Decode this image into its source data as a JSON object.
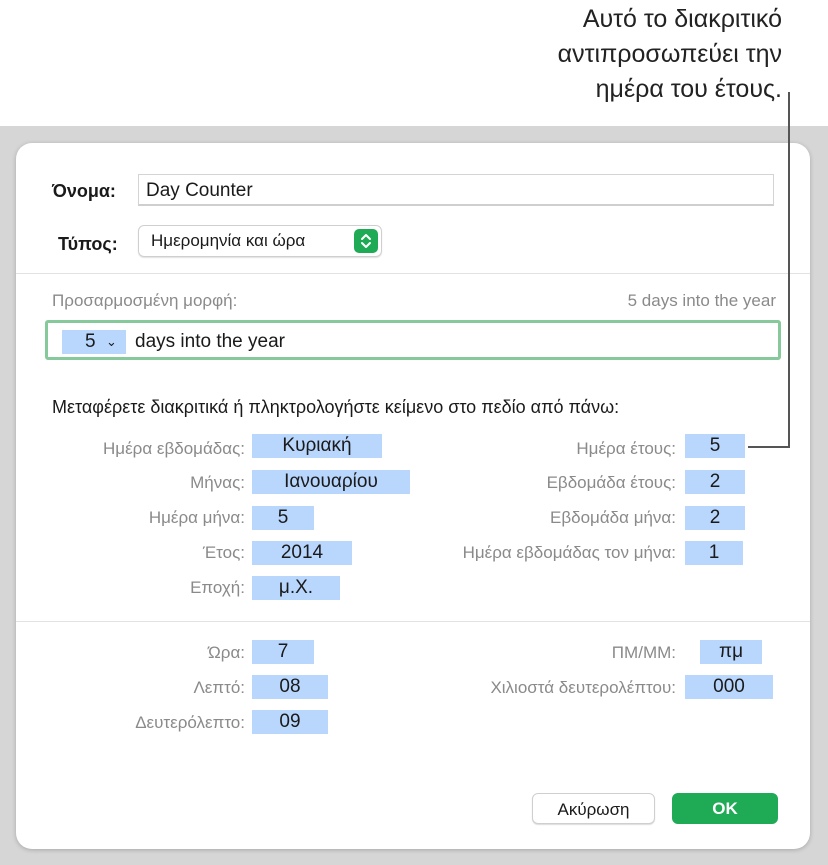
{
  "callout": [
    "Αυτό το διακριτικό",
    "αντιπροσωπεύει την",
    "ημέρα του έτους."
  ],
  "dialog": {
    "name_label": "Όνομα:",
    "name_value": "Day Counter",
    "type_label": "Τύπος:",
    "type_value": "Ημερομηνία και ώρα",
    "custom_format_label": "Προσαρμοσμένη μορφή:",
    "preview_text": "5 days into the year",
    "format_token_value": "5",
    "format_token_chevron": "⌄",
    "format_text": "days into the year",
    "instructions": "Μεταφέρετε διακριτικά ή πληκτρολογήστε κείμενο στο πεδίο από πάνω:",
    "date_tokens_left": [
      {
        "label": "Ημέρα εβδομάδας:",
        "value": "Κυριακή"
      },
      {
        "label": "Μήνας:",
        "value": "Ιανουαρίου"
      },
      {
        "label": "Ημέρα μήνα:",
        "value": "5"
      },
      {
        "label": "Έτος:",
        "value": "2014"
      },
      {
        "label": "Εποχή:",
        "value": "μ.Χ."
      }
    ],
    "date_tokens_right": [
      {
        "label": "Ημέρα έτους:",
        "value": "5"
      },
      {
        "label": "Εβδομάδα έτους:",
        "value": "2"
      },
      {
        "label": "Εβδομάδα μήνα:",
        "value": "2"
      },
      {
        "label": "Ημέρα εβδομάδας τον μήνα:",
        "value": "1"
      }
    ],
    "time_tokens_left": [
      {
        "label": "Ώρα:",
        "value": "7"
      },
      {
        "label": "Λεπτό:",
        "value": "08"
      },
      {
        "label": "Δευτερόλεπτο:",
        "value": "09"
      }
    ],
    "time_tokens_right": [
      {
        "label": "ΠΜ/ΜΜ:",
        "value": "πμ"
      },
      {
        "label": "Χιλιοστά δευτερολέπτου:",
        "value": "000"
      }
    ],
    "cancel_label": "Ακύρωση",
    "ok_label": "OK"
  },
  "colors": {
    "token": "#b9d6fd",
    "accent_green": "#1faa56",
    "format_border": "#86c99a"
  }
}
